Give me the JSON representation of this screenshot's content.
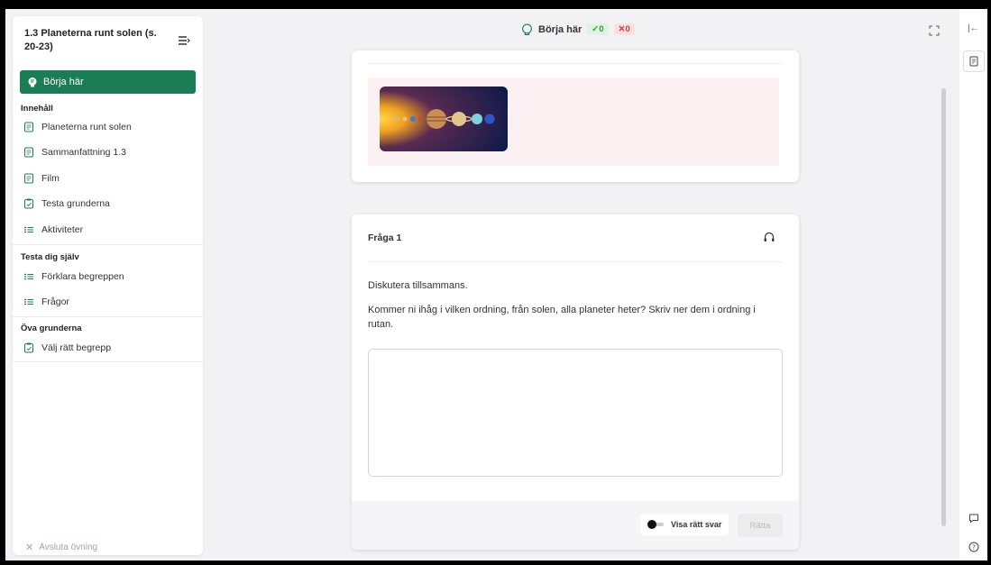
{
  "sidebar": {
    "title": "1.3 Planeterna runt solen (s. 20-23)",
    "start_label": "Börja här",
    "sections": [
      {
        "title": "Innehåll",
        "items": [
          "Planeterna runt solen",
          "Sammanfattning 1.3",
          "Film",
          "Testa grunderna",
          "Aktiviteter"
        ]
      },
      {
        "title": "Testa dig själv",
        "items": [
          "Förklara begreppen",
          "Frågor"
        ]
      },
      {
        "title": "Öva grunderna",
        "items": [
          "Välj rätt begrepp"
        ]
      }
    ],
    "footer_label": "Avsluta övning"
  },
  "topbar": {
    "title": "Börja här",
    "correct_count": "✓0",
    "wrong_count": "✕0"
  },
  "question": {
    "title": "Fråga 1",
    "prompt1": "Diskutera tillsammans.",
    "prompt2": "Kommer ni ihåg i vilken ordning, från solen, alla planeter heter? Skriv ner dem i ordning i rutan.",
    "answer_value": "",
    "show_answer_label": "Visa rätt svar",
    "check_label": "Rätta"
  },
  "colors": {
    "accent": "#1a7d56",
    "correct": "#2e9b3e",
    "wrong": "#d63a3a"
  }
}
